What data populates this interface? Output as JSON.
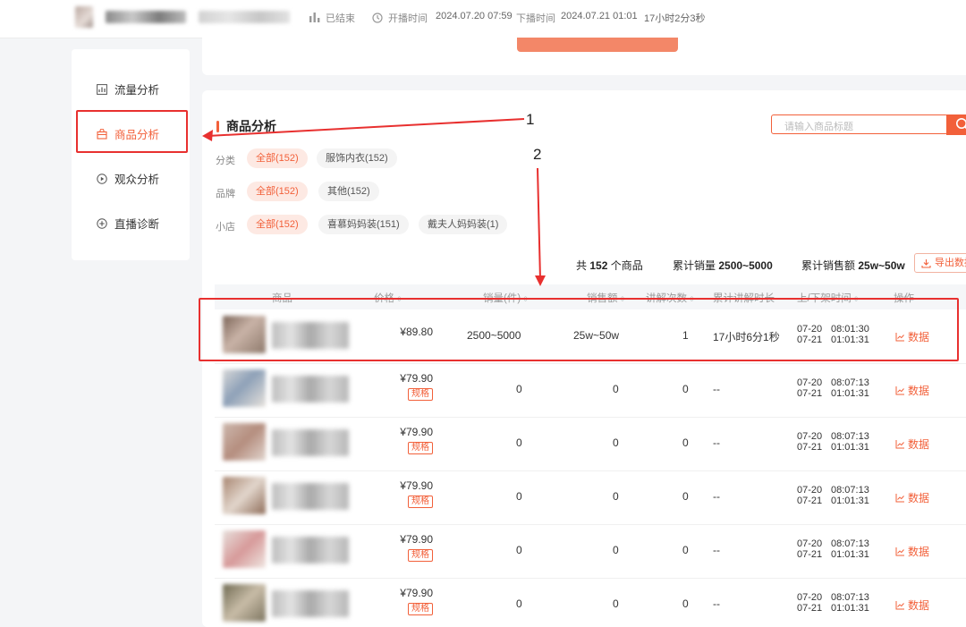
{
  "topbar": {
    "status": "已结束",
    "start_label": "开播时间",
    "start_time": "2024.07.20 07:59",
    "end_label": "下播时间",
    "end_time": "2024.07.21 01:01",
    "duration": "17小时2分3秒"
  },
  "sidebar": {
    "items": [
      {
        "label": "流量分析",
        "icon": "chart-box-icon"
      },
      {
        "label": "商品分析",
        "icon": "bag-icon",
        "active": true
      },
      {
        "label": "观众分析",
        "icon": "play-circle-icon"
      },
      {
        "label": "直播诊断",
        "icon": "plus-circle-icon"
      }
    ]
  },
  "section": {
    "title": "商品分析",
    "search_placeholder": "请输入商品标题"
  },
  "filters": {
    "category": {
      "label": "分类",
      "options": [
        "全部(152)",
        "服饰内衣(152)"
      ]
    },
    "brand": {
      "label": "品牌",
      "options": [
        "全部(152)",
        "其他(152)"
      ]
    },
    "shop": {
      "label": "小店",
      "options": [
        "全部(152)",
        "喜慕妈妈装(151)",
        "戴夫人妈妈装(1)"
      ]
    }
  },
  "summary": {
    "count_prefix": "共",
    "count": "152",
    "count_suffix": "个商品",
    "sales_label": "累计销量",
    "sales_value": "2500~5000",
    "revenue_label": "累计销售额",
    "revenue_value": "25w~50w",
    "export_label": "导出数据"
  },
  "table": {
    "headers": [
      "商品",
      "价格",
      "销量(件)",
      "销售额",
      "讲解次数",
      "累计讲解时长",
      "上/下架时间",
      "操作"
    ],
    "spec_label": "规格",
    "action_label": "数据",
    "rows": [
      {
        "price": "¥89.80",
        "sales": "2500~5000",
        "revenue": "25w~50w",
        "explain": "1",
        "duration": "17小时6分1秒",
        "up_date": "07-20",
        "up_time": "08:01:30",
        "down_date": "07-21",
        "down_time": "01:01:31",
        "spec": false
      },
      {
        "price": "¥79.90",
        "sales": "0",
        "revenue": "0",
        "explain": "0",
        "duration": "--",
        "up_date": "07-20",
        "up_time": "08:07:13",
        "down_date": "07-21",
        "down_time": "01:01:31",
        "spec": true
      },
      {
        "price": "¥79.90",
        "sales": "0",
        "revenue": "0",
        "explain": "0",
        "duration": "--",
        "up_date": "07-20",
        "up_time": "08:07:13",
        "down_date": "07-21",
        "down_time": "01:01:31",
        "spec": true
      },
      {
        "price": "¥79.90",
        "sales": "0",
        "revenue": "0",
        "explain": "0",
        "duration": "--",
        "up_date": "07-20",
        "up_time": "08:07:13",
        "down_date": "07-21",
        "down_time": "01:01:31",
        "spec": true
      },
      {
        "price": "¥79.90",
        "sales": "0",
        "revenue": "0",
        "explain": "0",
        "duration": "--",
        "up_date": "07-20",
        "up_time": "08:07:13",
        "down_date": "07-21",
        "down_time": "01:01:31",
        "spec": true
      },
      {
        "price": "¥79.90",
        "sales": "0",
        "revenue": "0",
        "explain": "0",
        "duration": "--",
        "up_date": "07-20",
        "up_time": "08:07:13",
        "down_date": "07-21",
        "down_time": "01:01:31",
        "spec": true
      }
    ]
  },
  "annotations": {
    "one": "1",
    "two": "2"
  },
  "colors": {
    "accent": "#f2603a",
    "highlight": "#e8302f"
  }
}
